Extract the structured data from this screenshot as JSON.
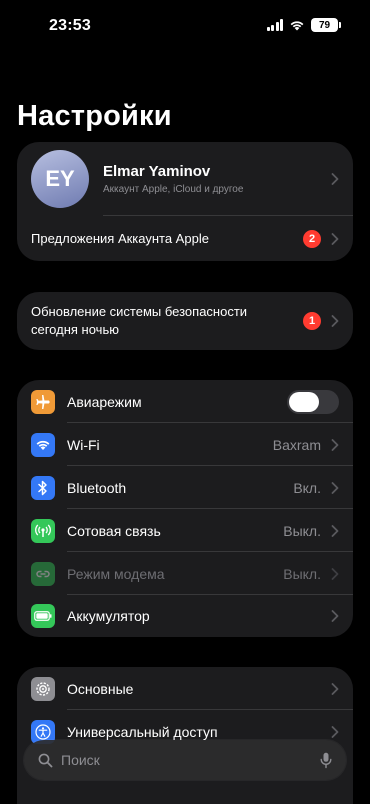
{
  "status_bar": {
    "time": "23:53",
    "battery": "79"
  },
  "title": "Настройки",
  "profile": {
    "initials": "EY",
    "name": "Elmar Yaminov",
    "subtitle": "Аккаунт Apple, iCloud и другое",
    "suggestions_label": "Предложения Аккаунта Apple",
    "suggestions_badge": "2"
  },
  "update": {
    "label_line1": "Обновление системы безопасности",
    "label_line2": "сегодня ночью",
    "badge": "1"
  },
  "connectivity": [
    {
      "label": "Авиарежим",
      "icon": "airplane-icon",
      "color": "#f09a37",
      "toggle": false
    },
    {
      "label": "Wi-Fi",
      "icon": "wifi-icon",
      "color": "#3478f6",
      "value": "Baxram"
    },
    {
      "label": "Bluetooth",
      "icon": "bluetooth-icon",
      "color": "#3478f6",
      "value": "Вкл."
    },
    {
      "label": "Сотовая связь",
      "icon": "cellular-icon",
      "color": "#34c759",
      "value": "Выкл."
    },
    {
      "label": "Режим модема",
      "icon": "hotspot-icon",
      "color": "#34c759",
      "value": "Выкл.",
      "disabled": true
    },
    {
      "label": "Аккумулятор",
      "icon": "battery-icon",
      "color": "#34c759"
    }
  ],
  "general": [
    {
      "label": "Основные",
      "icon": "gear-icon",
      "color": "#8e8e93"
    },
    {
      "label": "Универсальный доступ",
      "icon": "accessibility-icon",
      "color": "#3478f6"
    }
  ],
  "search": {
    "placeholder": "Поиск"
  }
}
